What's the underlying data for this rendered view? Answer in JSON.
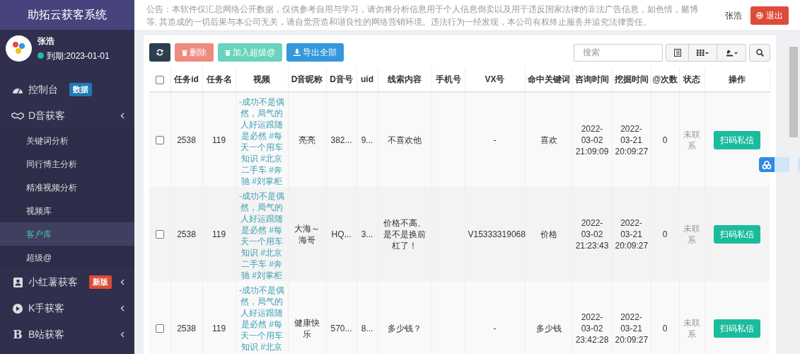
{
  "sidebar": {
    "title": "助拓云获客系统",
    "user": {
      "name": "张浩",
      "expiry": "到期:2023-01-01",
      "online": true
    },
    "items": [
      {
        "kind": "dashboard",
        "label": "控制台",
        "selected": false,
        "badge": {
          "text": "数据",
          "color": "#1f78b4"
        }
      },
      {
        "kind": "handshake",
        "label": "D音获客",
        "selected": false,
        "children": [
          {
            "label": "关键词分析",
            "selected": false
          },
          {
            "label": "同行博主分析",
            "selected": false
          },
          {
            "label": "精准视频分析",
            "selected": false
          },
          {
            "label": "视频库",
            "selected": false
          },
          {
            "label": "客户库",
            "selected": true
          },
          {
            "label": "超级@",
            "selected": false
          }
        ]
      },
      {
        "kind": "book",
        "label": "小红薯获客",
        "selected": false,
        "badge": {
          "text": "新版",
          "color": "#dd4b39"
        }
      },
      {
        "kind": "play",
        "label": "K手获客",
        "selected": false
      },
      {
        "kind": "letter",
        "glyph": "B",
        "label": "B站获客",
        "selected": false
      }
    ]
  },
  "header": {
    "notice": "公告：本软件仅汇总网络公开数据，仅供参考自用与学习，请勿将分析信息用于个人信息倒卖以及用于违反国家法律的非法广告信息，如色情，赌博等, 其造成的一切后果与本公司无关，请自觉营造和谐良性的网络营销环境。违法行为一经发现，本公司有权终止服务并追究法律责任。",
    "user_name": "张浩",
    "logout": "退出"
  },
  "toolbar": {
    "buttons": [
      {
        "kind": "refresh",
        "disabled": false
      },
      {
        "kind": "delete",
        "label": "删除",
        "disabled": true
      },
      {
        "kind": "add",
        "label": "加入超级@",
        "disabled": true
      },
      {
        "kind": "export",
        "label": "导出全部",
        "disabled": false
      }
    ],
    "search": {
      "placeholder": "搜索"
    }
  },
  "table": {
    "header_checked": false,
    "columns": [
      "任务id",
      "任务名",
      "视频",
      "D音昵称",
      "D音号",
      "uid",
      "线索内容",
      "手机号",
      "VX号",
      "命中关键词",
      "咨询时间",
      "挖掘时间",
      "@次数",
      "状态",
      "操作"
    ],
    "rows": [
      {
        "checked": false,
        "task_id": "2538",
        "task_name": "119",
        "video": "-成功不是偶然，局气的人好运跟随是必然 #每天一个用车知识 #北京二手车 #奔驰 #刘掌柜",
        "nickname": "亮亮",
        "d_id": "382...",
        "uid": "9...",
        "clue": "不喜欢他",
        "phone": "",
        "vx": "-",
        "keyword": "喜欢",
        "consult_time": "2022-03-02 21:09:09",
        "mine_time": "2022-03-21 20:09:27",
        "at_count": "0",
        "status": "未联系",
        "action": "扫码私信"
      },
      {
        "checked": false,
        "task_id": "2538",
        "task_name": "119",
        "video": "-成功不是偶然，局气的人好运跟随是必然 #每天一个用车知识 #北京二手车 #奔驰 #刘掌柜",
        "nickname": "大海～海哥",
        "d_id": "HQ...",
        "uid": "3...",
        "clue": "价格不高、是不是换前杠了！",
        "phone": "",
        "vx": "V15333319068",
        "keyword": "价格",
        "consult_time": "2022-03-02 21:23:43",
        "mine_time": "2022-03-21 20:09:27",
        "at_count": "0",
        "status": "未联系",
        "action": "扫码私信"
      },
      {
        "checked": false,
        "task_id": "2538",
        "task_name": "119",
        "video": "-成功不是偶然，局气的人好运跟随是必然 #每天一个用车知识 #北京",
        "nickname": "健康快乐",
        "d_id": "570...",
        "uid": "8...",
        "clue": "多少钱？",
        "phone": "",
        "vx": "-",
        "keyword": "多少钱",
        "consult_time": "2022-03-02 23:42:28",
        "mine_time": "2022-03-21 20:09:27",
        "at_count": "0",
        "status": "未联系",
        "action": "扫码私信"
      }
    ]
  }
}
